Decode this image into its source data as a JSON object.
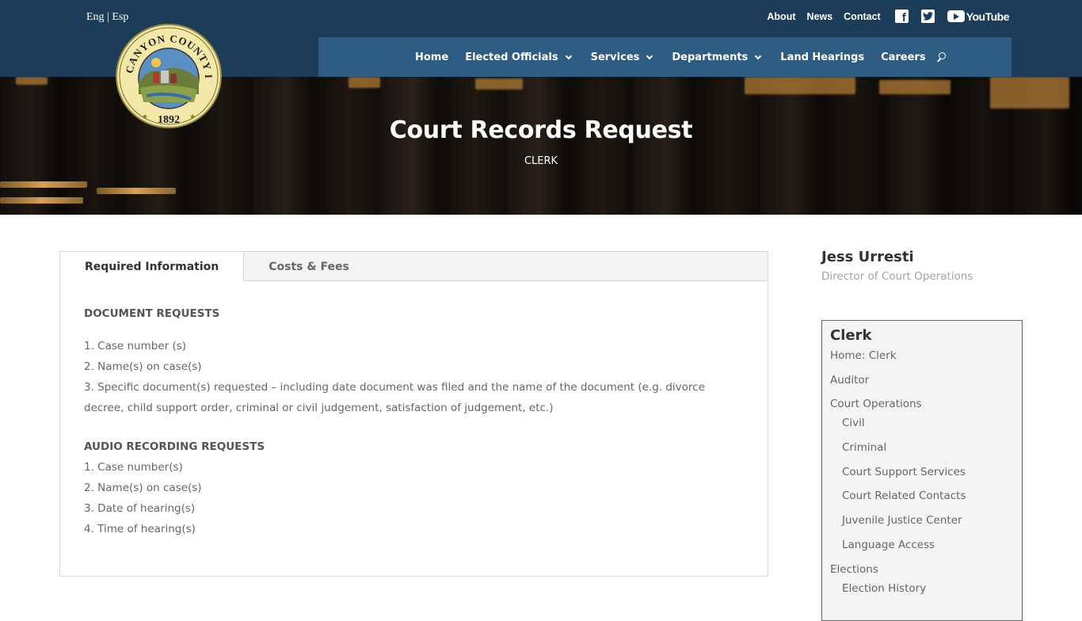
{
  "header": {
    "lang_en": "Eng",
    "lang_sep": "|",
    "lang_es": "Esp",
    "top_links": [
      "About",
      "News",
      "Contact"
    ],
    "youtube_label": "YouTube",
    "nav": [
      {
        "label": "Home",
        "dropdown": false
      },
      {
        "label": "Elected Officials",
        "dropdown": true
      },
      {
        "label": "Services",
        "dropdown": true
      },
      {
        "label": "Departments",
        "dropdown": true
      },
      {
        "label": "Land Hearings",
        "dropdown": false
      },
      {
        "label": "Careers",
        "dropdown": false
      }
    ],
    "seal": {
      "top_text": "CANYON COUNTY IDAHO",
      "year": "1892"
    }
  },
  "hero": {
    "title": "Court Records Request",
    "subtitle": "CLERK"
  },
  "tabs": {
    "items": [
      "Required Information",
      "Costs & Fees"
    ],
    "active": 0
  },
  "content": {
    "doc_heading": "DOCUMENT REQUESTS",
    "doc_items": [
      "1. Case number (s)",
      "2. Name(s) on case(s)",
      "3. Specific document(s) requested – including date document was filed and the name of the document (e.g. divorce decree, child support order, criminal or civil judgement, satisfaction of judgement, etc.)"
    ],
    "audio_heading": "AUDIO RECORDING REQUESTS",
    "audio_items": [
      "1. Case number(s)",
      "2. Name(s) on case(s)",
      "3. Date of hearing(s)",
      "4. Time of hearing(s)"
    ]
  },
  "sidebar": {
    "person_name": "Jess Urresti",
    "person_title": "Director of Court Operations",
    "menu_title": "Clerk",
    "menu": [
      {
        "label": "Home: Clerk",
        "sub": false
      },
      {
        "label": "Auditor",
        "sub": false
      },
      {
        "label": "Court Operations",
        "sub": false
      },
      {
        "label": "Civil",
        "sub": true
      },
      {
        "label": "Criminal",
        "sub": true
      },
      {
        "label": "Court Support Services",
        "sub": true
      },
      {
        "label": "Court Related Contacts",
        "sub": true
      },
      {
        "label": "Juvenile Justice Center",
        "sub": true
      },
      {
        "label": "Language Access",
        "sub": true
      },
      {
        "label": "Elections",
        "sub": false
      },
      {
        "label": "Election History",
        "sub": true
      }
    ]
  },
  "colors": {
    "header_bg": "#1c3d5a",
    "nav_bg": "#2f5c82",
    "text_gray": "#666666"
  }
}
